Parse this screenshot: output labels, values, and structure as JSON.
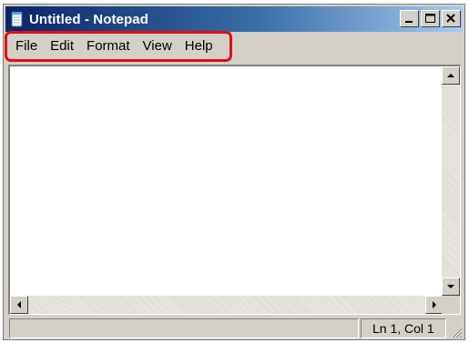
{
  "window": {
    "title": "Untitled - Notepad",
    "icon": "notepad-icon"
  },
  "title_buttons": {
    "minimize": "minimize-icon",
    "maximize": "maximize-icon",
    "close": "close-icon"
  },
  "menu": {
    "items": [
      {
        "label": "File"
      },
      {
        "label": "Edit"
      },
      {
        "label": "Format"
      },
      {
        "label": "View"
      },
      {
        "label": "Help"
      }
    ],
    "highlight_color": "#e01010"
  },
  "editor": {
    "content": ""
  },
  "status": {
    "position": "Ln 1, Col 1"
  },
  "colors": {
    "titlebar_start": "#0a246a",
    "titlebar_end": "#a6caf0",
    "chrome": "#d4d0c8"
  }
}
